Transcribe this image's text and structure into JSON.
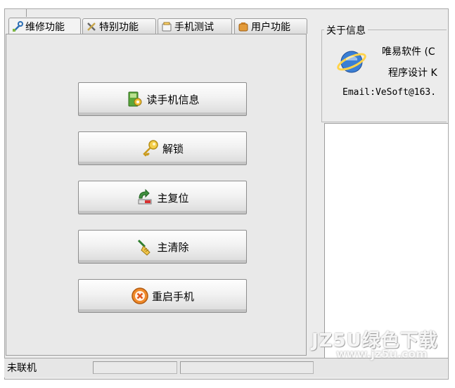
{
  "tabs": [
    {
      "label": "维修功能",
      "icon": "repair-icon"
    },
    {
      "label": "特别功能",
      "icon": "tools-icon"
    },
    {
      "label": "手机测试",
      "icon": "phone-test-icon"
    },
    {
      "label": "用户功能",
      "icon": "user-icon"
    }
  ],
  "actions": [
    {
      "label": "读手机信息",
      "icon": "read-info-icon"
    },
    {
      "label": "解锁",
      "icon": "key-icon"
    },
    {
      "label": "主复位",
      "icon": "reset-icon"
    },
    {
      "label": "主清除",
      "icon": "broom-icon"
    },
    {
      "label": "重启手机",
      "icon": "restart-icon"
    }
  ],
  "about": {
    "legend": "关于信息",
    "line1": "唯易软件 (C",
    "line2": "程序设计 K",
    "email": "Email:VeSoft@163."
  },
  "status": {
    "text": "未联机"
  },
  "watermark": {
    "brand": "JZ5U绿色下载",
    "url": "www.jz5u.com"
  },
  "colors": {
    "window_bg": "#ececec",
    "button_border": "#8d8d8d"
  }
}
